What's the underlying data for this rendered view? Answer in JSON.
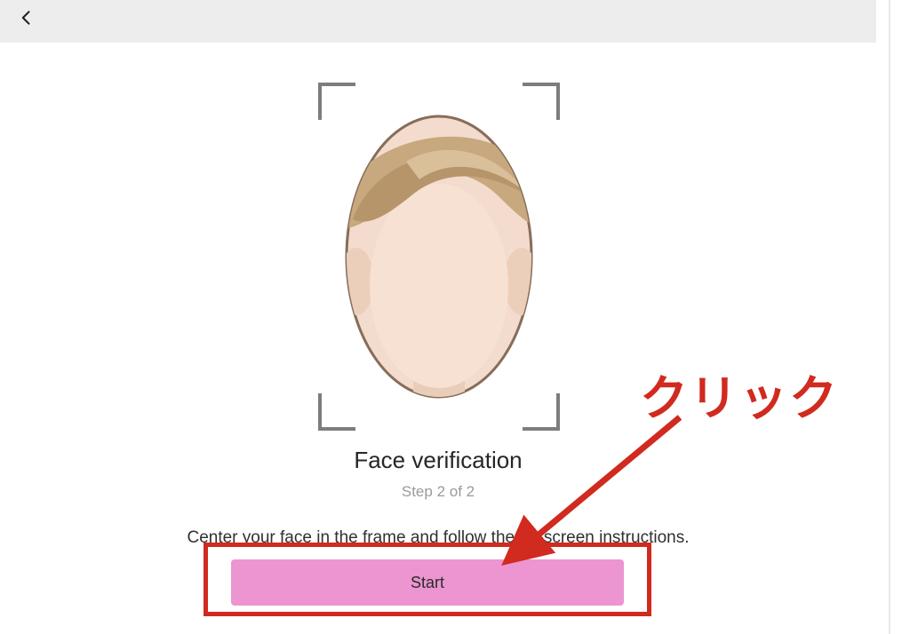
{
  "title": "Face verification",
  "step_label": "Step 2 of 2",
  "instruction": "Center your face in the frame and follow the on-screen instructions.",
  "start_label": "Start",
  "annotation_text": "クリック",
  "colors": {
    "accent_button": "#ec95d0",
    "annotation": "#d12a1f",
    "topbar": "#ededed",
    "frame_bracket": "#7d7d7d"
  },
  "icons": {
    "back": "chevron-left-icon",
    "face": "face-avatar-icon",
    "arrow": "annotation-arrow-icon"
  }
}
